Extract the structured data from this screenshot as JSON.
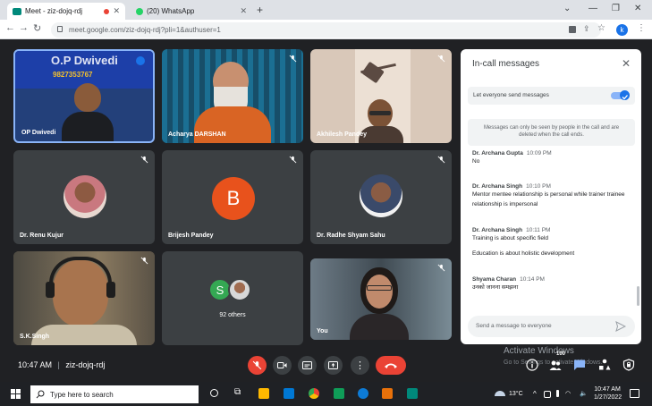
{
  "browser": {
    "tabs": [
      {
        "title": "Meet - ziz-dojq-rdj",
        "active": true
      },
      {
        "title": "(20) WhatsApp",
        "active": false
      }
    ],
    "new_tab": "+",
    "url": "meet.google.com/ziz-dojq-rdj?pli=1&authuser=1",
    "profile_initial": "k"
  },
  "tiles": [
    {
      "name": "OP Dwivedi",
      "banner": "O.P Dwivedi",
      "banner_number": "9827353767"
    },
    {
      "name": "Acharya DARSHAN"
    },
    {
      "name": "Akhilesh Pandey"
    },
    {
      "name": "Dr. Renu Kujur"
    },
    {
      "name": "Brijesh Pandey",
      "initial": "B"
    },
    {
      "name": "Dr. Radhe Shyam Sahu"
    },
    {
      "name": "S.K.Singh"
    },
    {
      "name": "92 others",
      "initial": "S"
    },
    {
      "name": "You"
    }
  ],
  "chat": {
    "title": "In-call messages",
    "toggle_label": "Let everyone send messages",
    "notice": "Messages can only be seen by people in the call and are deleted when the call ends.",
    "messages": [
      {
        "sender": "Dr. Archana Gupta",
        "time": "10:09 PM",
        "lines": [
          "No"
        ]
      },
      {
        "sender": "Dr. Archana Singh",
        "time": "10:10 PM",
        "lines": [
          "Mentor mentee relationship is personal while trainer trainee relationship is impersonal"
        ]
      },
      {
        "sender": "Dr. Archana Singh",
        "time": "10:11 PM",
        "lines": [
          "Training is about specific field",
          "Education is about holistic development"
        ]
      },
      {
        "sender": "Shyama Charan",
        "time": "10:14 PM",
        "lines": [
          "उनको जानना समझना"
        ]
      }
    ],
    "input_placeholder": "Send a message to everyone"
  },
  "controls": {
    "time": "10:47 AM",
    "separator": "|",
    "meeting_code": "ziz-dojq-rdj",
    "participant_count": "100"
  },
  "watermark": {
    "line1": "Activate Windows",
    "line2": "Go to Settings to activate Windows."
  },
  "taskbar": {
    "search_placeholder": "Type here to search",
    "temperature": "13°C",
    "time": "10:47 AM",
    "date": "1/27/2022"
  },
  "colors": {
    "meet_bg": "#202124",
    "tile_bg": "#3c4043",
    "end_call": "#ea4335",
    "accent": "#1a73e8",
    "avatar_orange": "#e8521c",
    "avatar_green": "#34a853"
  }
}
